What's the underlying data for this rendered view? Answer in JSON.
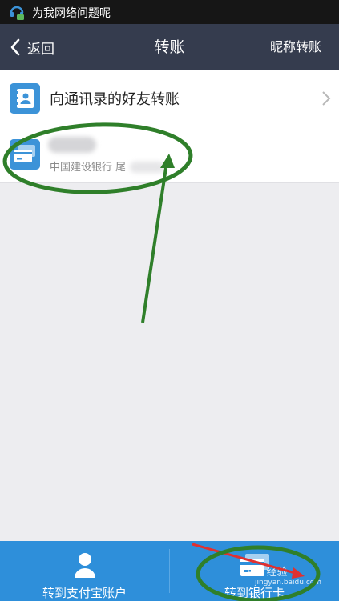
{
  "status_bar": {
    "notification_text": "为我网络问题呢"
  },
  "nav": {
    "back_label": "返回",
    "title": "转账",
    "right_action": "昵称转账"
  },
  "list": {
    "contacts_row": {
      "title": "向通讯录的好友转账"
    },
    "bank_card_row": {
      "subtitle": "中国建设银行 尾"
    }
  },
  "bottom_tabs": [
    {
      "label": "转到支付宝账户",
      "icon": "user-icon"
    },
    {
      "label": "转到银行卡",
      "icon": "bank-card-icon"
    }
  ],
  "watermark": {
    "main": "Bai 经验",
    "sub": "jingyan.baidu.com"
  },
  "colors": {
    "status_bar": "#161616",
    "nav_bar": "#353c4e",
    "bottom_bar": "#2e8fda",
    "list_icon": "#3c93d8",
    "annotation_green": "#2f7f2a",
    "annotation_red": "#e03030"
  }
}
